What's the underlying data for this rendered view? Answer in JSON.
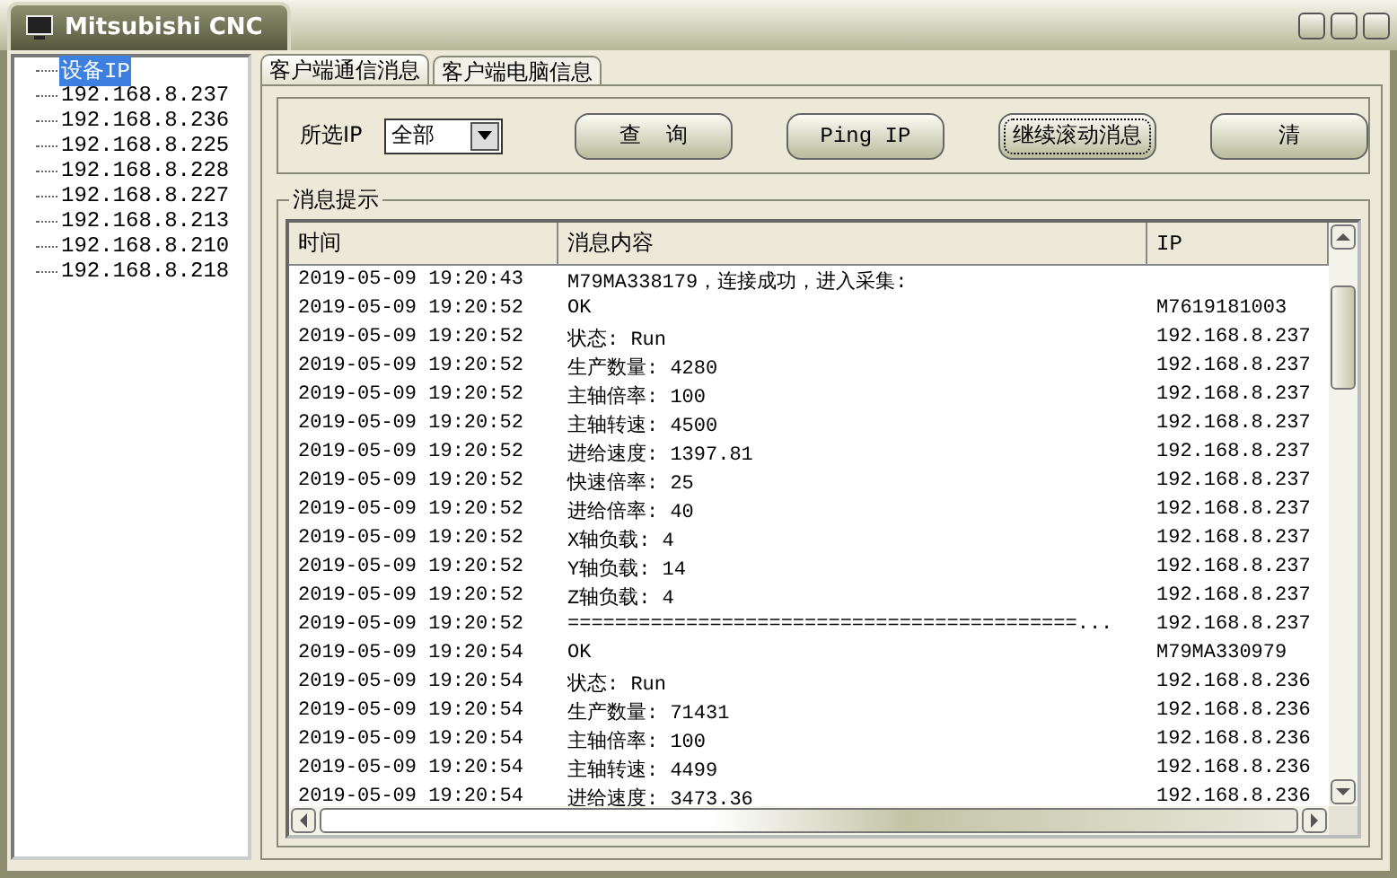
{
  "window": {
    "title": "Mitsubishi CNC"
  },
  "tree": {
    "root": {
      "label": "设备IP",
      "selected": true
    },
    "children": [
      {
        "label": "192.168.8.237",
        "selected": false
      },
      {
        "label": "192.168.8.236",
        "selected": false
      },
      {
        "label": "192.168.8.225",
        "selected": false
      },
      {
        "label": "192.168.8.228",
        "selected": false
      },
      {
        "label": "192.168.8.227",
        "selected": false
      },
      {
        "label": "192.168.8.213",
        "selected": false
      },
      {
        "label": "192.168.8.210",
        "selected": false
      },
      {
        "label": "192.168.8.218",
        "selected": false
      }
    ]
  },
  "tabs": [
    {
      "label": "客户端通信消息",
      "selected": true
    },
    {
      "label": "客户端电脑信息",
      "selected": false
    }
  ],
  "filter": {
    "label": "所选IP",
    "value": "全部"
  },
  "buttons": [
    {
      "label": "查  询",
      "focused": false
    },
    {
      "label": "Ping IP",
      "focused": false
    },
    {
      "label": "继续滚动消息",
      "focused": true
    },
    {
      "label": "清",
      "focused": false
    }
  ],
  "messages": {
    "title": "消息提示",
    "columns": [
      "时间",
      "消息内容",
      "IP"
    ],
    "rows": [
      [
        "2019-05-09 19:20:43",
        "M79MA338179，连接成功，进入采集:",
        ""
      ],
      [
        "2019-05-09 19:20:52",
        "OK",
        "M7619181003"
      ],
      [
        "2019-05-09 19:20:52",
        "状态: Run",
        "192.168.8.237"
      ],
      [
        "2019-05-09 19:20:52",
        "生产数量: 4280",
        "192.168.8.237"
      ],
      [
        "2019-05-09 19:20:52",
        "主轴倍率: 100",
        "192.168.8.237"
      ],
      [
        "2019-05-09 19:20:52",
        "主轴转速: 4500",
        "192.168.8.237"
      ],
      [
        "2019-05-09 19:20:52",
        "进给速度: 1397.81",
        "192.168.8.237"
      ],
      [
        "2019-05-09 19:20:52",
        "快速倍率: 25",
        "192.168.8.237"
      ],
      [
        "2019-05-09 19:20:52",
        "进给倍率: 40",
        "192.168.8.237"
      ],
      [
        "2019-05-09 19:20:52",
        "X轴负载: 4",
        "192.168.8.237"
      ],
      [
        "2019-05-09 19:20:52",
        "Y轴负载: 14",
        "192.168.8.237"
      ],
      [
        "2019-05-09 19:20:52",
        "Z轴负载: 4",
        "192.168.8.237"
      ],
      [
        "2019-05-09 19:20:52",
        "===========================================...",
        "192.168.8.237"
      ],
      [
        "2019-05-09 19:20:54",
        "OK",
        "M79MA330979"
      ],
      [
        "2019-05-09 19:20:54",
        "状态: Run",
        "192.168.8.236"
      ],
      [
        "2019-05-09 19:20:54",
        "生产数量: 71431",
        "192.168.8.236"
      ],
      [
        "2019-05-09 19:20:54",
        "主轴倍率: 100",
        "192.168.8.236"
      ],
      [
        "2019-05-09 19:20:54",
        "主轴转速: 4499",
        "192.168.8.236"
      ],
      [
        "2019-05-09 19:20:54",
        "进给速度: 3473.36",
        "192.168.8.236"
      ]
    ]
  }
}
